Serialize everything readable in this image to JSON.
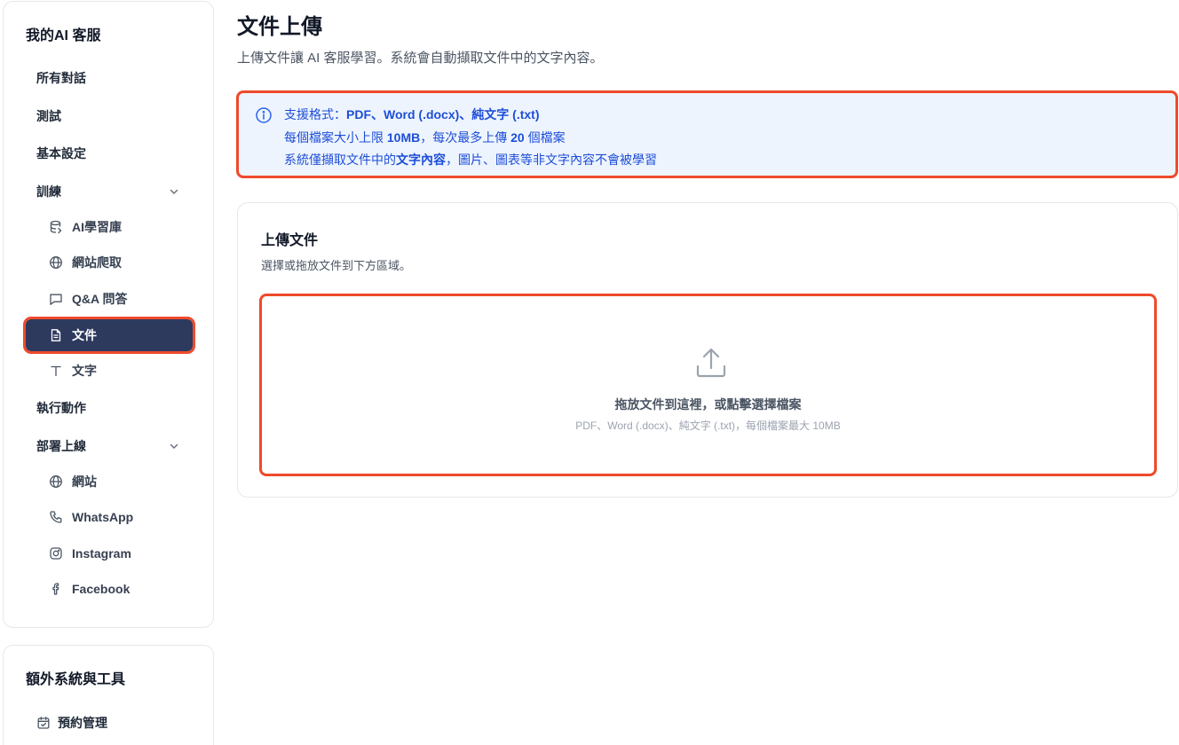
{
  "sidebar": {
    "brand": "我的AI 客服",
    "items": {
      "all_conversations": "所有對話",
      "test": "測試",
      "basic_settings": "基本設定",
      "training": "訓練",
      "actions": "執行動作",
      "deploy": "部署上線"
    },
    "training_sub": {
      "library": "AI學習庫",
      "crawler": "網站爬取",
      "qa": "Q&A 問答",
      "documents": "文件",
      "text": "文字"
    },
    "deploy_sub": {
      "website": "網站",
      "whatsapp": "WhatsApp",
      "instagram": "Instagram",
      "facebook": "Facebook"
    },
    "tools": {
      "title": "額外系統與工具",
      "booking": "預約管理"
    }
  },
  "main": {
    "title": "文件上傳",
    "subtitle": "上傳文件讓 AI 客服學習。系統會自動擷取文件中的文字內容。",
    "info": {
      "line1_prefix": "支援格式：",
      "line1_bold": "PDF、Word (.docx)、純文字 (.txt)",
      "line2_a": "每個檔案大小上限 ",
      "line2_b": "10MB",
      "line2_c": "，每次最多上傳 ",
      "line2_d": "20",
      "line2_e": " 個檔案",
      "line3_a": "系統僅擷取文件中的",
      "line3_b": "文字內容",
      "line3_c": "，圖片、圖表等非文字內容不會被學習"
    },
    "upload": {
      "title": "上傳文件",
      "subtitle": "選擇或拖放文件到下方區域。",
      "drop_text": "拖放文件到這裡，或點擊選擇檔案",
      "drop_hint": "PDF、Word (.docx)、純文字 (.txt)，每個檔案最大 10MB"
    }
  },
  "colors": {
    "active_nav": "#2d3a5e",
    "highlight": "#ef4a2b",
    "info_bg": "#eef4fd",
    "info_text": "#1d4ed8"
  }
}
